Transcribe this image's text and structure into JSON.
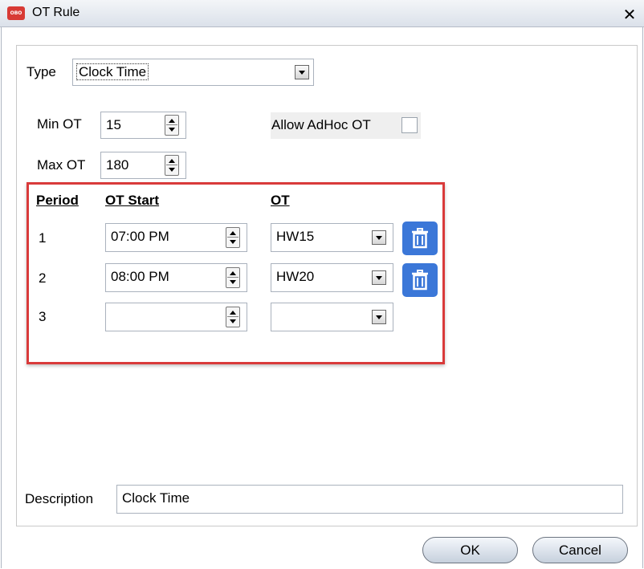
{
  "window": {
    "title": "OT Rule",
    "app_icon_text": "OBO"
  },
  "form": {
    "type_label": "Type",
    "type_value": "Clock Time",
    "min_ot_label": "Min OT",
    "min_ot_value": "15",
    "max_ot_label": "Max OT",
    "max_ot_value": "180",
    "allow_adhoc_label": "Allow AdHoc OT",
    "allow_adhoc_checked": false
  },
  "periods": {
    "headers": {
      "period": "Period",
      "ot_start": "OT Start",
      "ot": "OT"
    },
    "rows": [
      {
        "period": "1",
        "ot_start": "07:00 PM",
        "ot": "HW15"
      },
      {
        "period": "2",
        "ot_start": "08:00 PM",
        "ot": "HW20"
      },
      {
        "period": "3",
        "ot_start": "",
        "ot": ""
      }
    ]
  },
  "description": {
    "label": "Description",
    "value": "Clock Time"
  },
  "buttons": {
    "ok": "OK",
    "cancel": "Cancel"
  },
  "colors": {
    "highlight": "#d93a3a",
    "delete_button": "#3b77d8",
    "app_icon": "#d83a35"
  }
}
